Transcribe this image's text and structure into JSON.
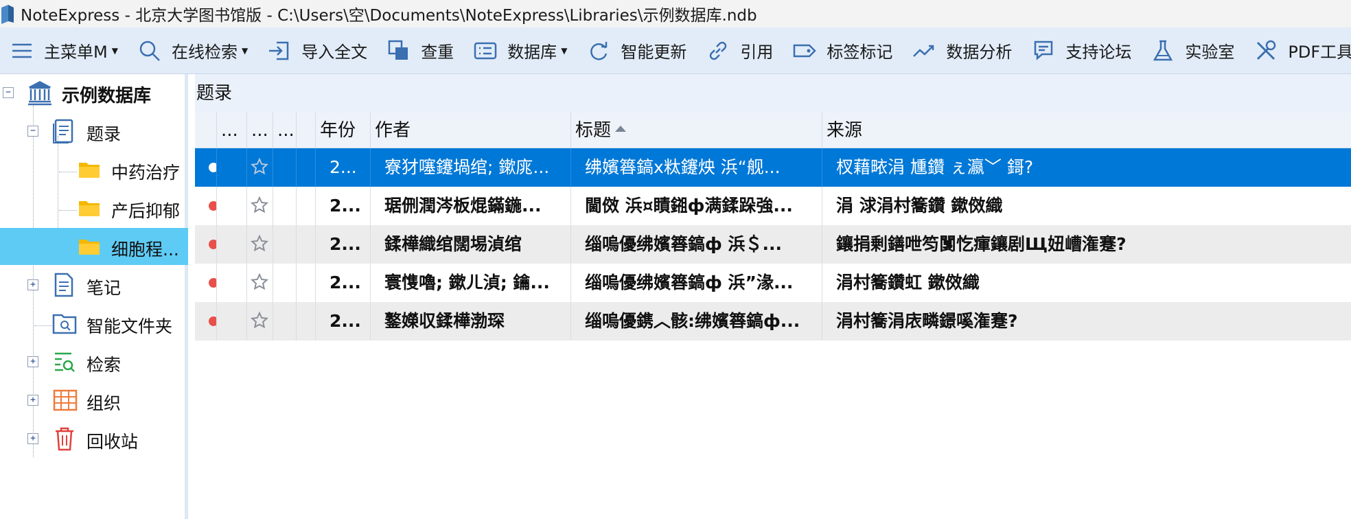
{
  "window": {
    "title": "NoteExpress - 北京大学图书馆版 - C:\\Users\\空\\Documents\\NoteExpress\\Libraries\\示例数据库.ndb"
  },
  "toolbar": {
    "items": [
      {
        "label": "主菜单M",
        "icon": "hamburger-menu-icon",
        "has_caret": true
      },
      {
        "label": "在线检索",
        "icon": "search-icon",
        "has_caret": true
      },
      {
        "label": "导入全文",
        "icon": "import-icon",
        "has_caret": false
      },
      {
        "label": "查重",
        "icon": "duplicate-check-icon",
        "has_caret": false
      },
      {
        "label": "数据库",
        "icon": "database-icon",
        "has_caret": true
      },
      {
        "label": "智能更新",
        "icon": "refresh-icon",
        "has_caret": false
      },
      {
        "label": "引用",
        "icon": "link-icon",
        "has_caret": false
      },
      {
        "label": "标签标记",
        "icon": "tag-icon",
        "has_caret": false
      },
      {
        "label": "数据分析",
        "icon": "trend-icon",
        "has_caret": false
      },
      {
        "label": "支持论坛",
        "icon": "forum-icon",
        "has_caret": false
      },
      {
        "label": "实验室",
        "icon": "flask-icon",
        "has_caret": false
      },
      {
        "label": "PDF工具",
        "icon": "tools-icon",
        "has_caret": false
      }
    ]
  },
  "tree": {
    "root": {
      "label": "示例数据库",
      "expander": "−"
    },
    "items": [
      {
        "label": "题录",
        "expander": "−"
      },
      {
        "label": "中药治疗"
      },
      {
        "label": "产后抑郁"
      },
      {
        "label": "细胞程..."
      },
      {
        "label": "笔记",
        "expander": "+"
      },
      {
        "label": "智能文件夹"
      },
      {
        "label": "检索",
        "expander": "+"
      },
      {
        "label": "组织",
        "expander": "+"
      },
      {
        "label": "回收站",
        "expander": "+"
      }
    ]
  },
  "panel": {
    "title": "题录",
    "columns": [
      "...",
      "...",
      "...",
      "年份",
      "作者",
      "标题",
      "来源"
    ],
    "rows": [
      {
        "year": "2...",
        "author": "寮犲噻鑳堝绾; 鏉庣...",
        "title": "绋嬪簭鎬х粏鑳炴   浜“舰...",
        "source": "杈藉畩涓   尰鑽   ぇ瀛﹀   鎶?"
      },
      {
        "year": "2...",
        "author": "琚侀潤涔板焜鏋鍦...",
        "title": "閫傚   浜¤瞔鎺ф满鍒跺強...",
        "source": "涓   浗涓村簥鑽      鏉傚織"
      },
      {
        "year": "2...",
        "author": "鍒樺織绾闊埸湞绾",
        "title": "缁嗚優绋嬪簭鎬ф   浜＄...",
        "source": "鑲捐剰鐥呭笉闅忔瘒鑲剧Щ妞嶆潅蹇?"
      },
      {
        "year": "2...",
        "author": "寰愯嚕; 鏉ㄦ湞; 鑰...",
        "title": "缁嗚優绋嬪簭鎬ф   浜”湪...",
        "source": "涓村簥鑽虹   鏉傚織"
      },
      {
        "year": "2...",
        "author": "鐜嬫収鍒樺渤琛",
        "title": "缁嗚優鎸︿骸:绋嬪簭鎬ф...",
        "source": "涓村簥涓庡疄鐛嗘潅蹇?"
      }
    ]
  },
  "colors": {
    "toolbar_bg": "#e2ecf8",
    "selection_tree": "#5ecbf5",
    "selection_grid": "#0078d7",
    "status_dot": "#e8504a"
  }
}
